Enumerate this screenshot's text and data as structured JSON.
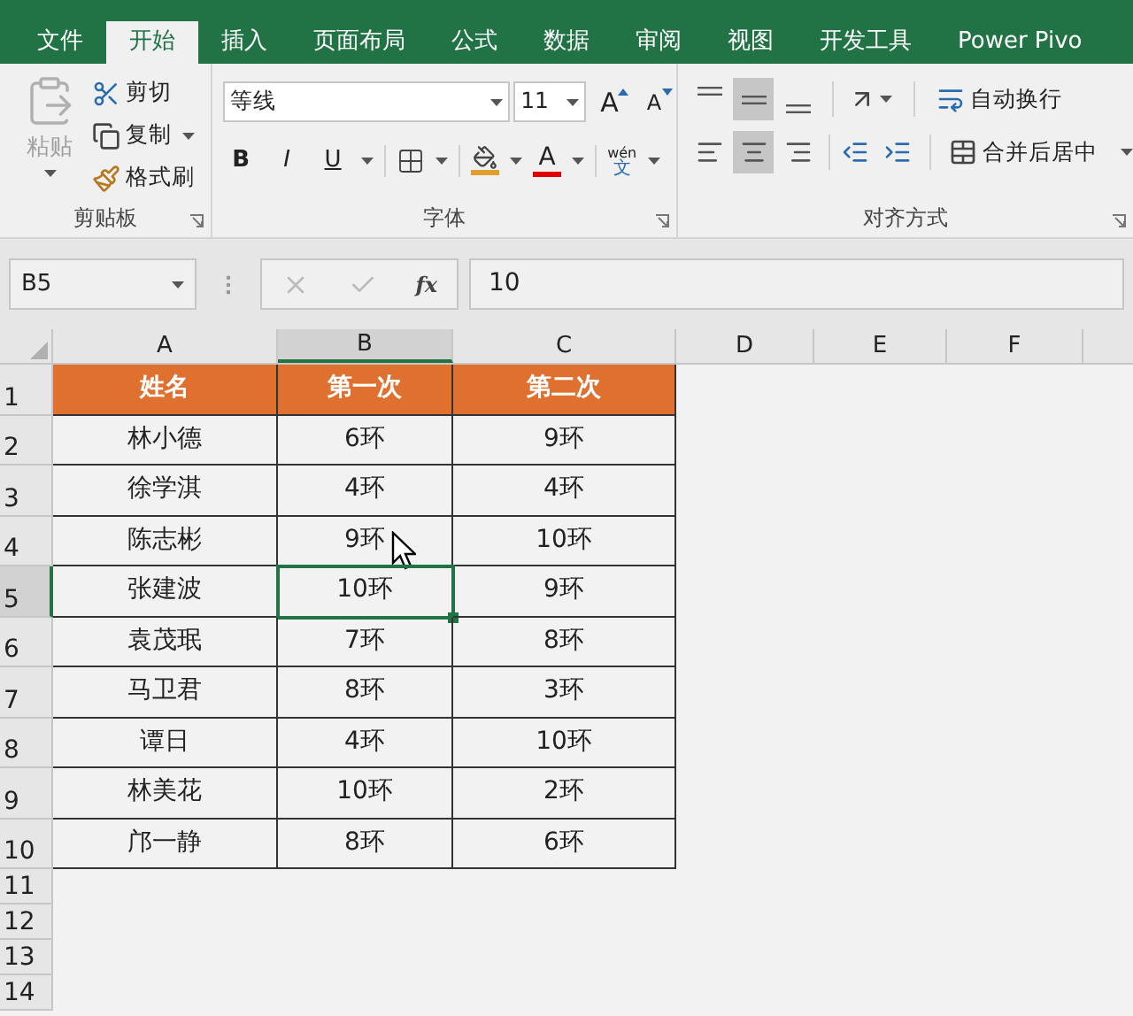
{
  "tabs": [
    {
      "label": "文件",
      "selected": false
    },
    {
      "label": "开始",
      "selected": true
    },
    {
      "label": "插入",
      "selected": false
    },
    {
      "label": "页面布局",
      "selected": false
    },
    {
      "label": "公式",
      "selected": false
    },
    {
      "label": "数据",
      "selected": false
    },
    {
      "label": "审阅",
      "selected": false
    },
    {
      "label": "视图",
      "selected": false
    },
    {
      "label": "开发工具",
      "selected": false
    },
    {
      "label": "Power Pivo",
      "selected": false
    }
  ],
  "ribbon": {
    "clipboard": {
      "title": "剪贴板",
      "paste": {
        "label": "粘贴",
        "disabled": true
      },
      "items": [
        "剪切",
        "复制",
        "格式刷"
      ]
    },
    "font": {
      "title": "字体",
      "name": "等线",
      "size": "11",
      "grow": "A",
      "shrink": "A",
      "styles": [
        "B",
        "I",
        "U"
      ],
      "font_color": "A",
      "phonetic_top": "wén",
      "phonetic_bottom": "文"
    },
    "alignment": {
      "title": "对齐方式",
      "vertical": [
        {
          "selected": false
        },
        {
          "selected": true
        },
        {
          "selected": false
        }
      ],
      "horizontal": [
        {
          "selected": false
        },
        {
          "selected": true
        },
        {
          "selected": false
        }
      ],
      "wrap": "自动换行",
      "merge": "合并后居中"
    }
  },
  "formula_bar": {
    "name_box": "B5",
    "fx": "fx",
    "value": "10"
  },
  "sheet": {
    "columns": [
      {
        "label": "A",
        "selected": false
      },
      {
        "label": "B",
        "selected": true
      },
      {
        "label": "C",
        "selected": false
      },
      {
        "label": "D",
        "selected": false
      },
      {
        "label": "E",
        "selected": false
      },
      {
        "label": "F",
        "selected": false
      }
    ],
    "row_numbers": [
      {
        "label": "1",
        "selected": false
      },
      {
        "label": "2",
        "selected": false
      },
      {
        "label": "3",
        "selected": false
      },
      {
        "label": "4",
        "selected": false
      },
      {
        "label": "5",
        "selected": true
      },
      {
        "label": "6",
        "selected": false
      },
      {
        "label": "7",
        "selected": false
      },
      {
        "label": "8",
        "selected": false
      },
      {
        "label": "9",
        "selected": false
      },
      {
        "label": "10",
        "selected": false
      },
      {
        "label": "11",
        "selected": false
      },
      {
        "label": "12",
        "selected": false
      },
      {
        "label": "13",
        "selected": false
      },
      {
        "label": "14",
        "selected": false
      }
    ],
    "rows": [
      {
        "kind": "header",
        "cells": [
          {
            "text": "姓名",
            "active": false
          },
          {
            "text": "第一次",
            "active": false
          },
          {
            "text": "第二次",
            "active": false
          }
        ]
      },
      {
        "kind": "data",
        "cells": [
          {
            "text": "林小德",
            "active": false
          },
          {
            "text": "6环",
            "active": false
          },
          {
            "text": "9环",
            "active": false
          }
        ]
      },
      {
        "kind": "data",
        "cells": [
          {
            "text": "徐学淇",
            "active": false
          },
          {
            "text": "4环",
            "active": false
          },
          {
            "text": "4环",
            "active": false
          }
        ]
      },
      {
        "kind": "data",
        "cells": [
          {
            "text": "陈志彬",
            "active": false
          },
          {
            "text": "9环",
            "active": false
          },
          {
            "text": "10环",
            "active": false
          }
        ]
      },
      {
        "kind": "data",
        "cells": [
          {
            "text": "张建波",
            "active": false
          },
          {
            "text": "10环",
            "active": true
          },
          {
            "text": "9环",
            "active": false
          }
        ]
      },
      {
        "kind": "data",
        "cells": [
          {
            "text": "袁茂珉",
            "active": false
          },
          {
            "text": "7环",
            "active": false
          },
          {
            "text": "8环",
            "active": false
          }
        ]
      },
      {
        "kind": "data",
        "cells": [
          {
            "text": "马卫君",
            "active": false
          },
          {
            "text": "8环",
            "active": false
          },
          {
            "text": "3环",
            "active": false
          }
        ]
      },
      {
        "kind": "data",
        "cells": [
          {
            "text": "谭日",
            "active": false
          },
          {
            "text": "4环",
            "active": false
          },
          {
            "text": "10环",
            "active": false
          }
        ]
      },
      {
        "kind": "data",
        "cells": [
          {
            "text": "林美花",
            "active": false
          },
          {
            "text": "10环",
            "active": false
          },
          {
            "text": "2环",
            "active": false
          }
        ]
      },
      {
        "kind": "data",
        "cells": [
          {
            "text": "邝一静",
            "active": false
          },
          {
            "text": "8环",
            "active": false
          },
          {
            "text": "6环",
            "active": false
          }
        ]
      }
    ]
  }
}
